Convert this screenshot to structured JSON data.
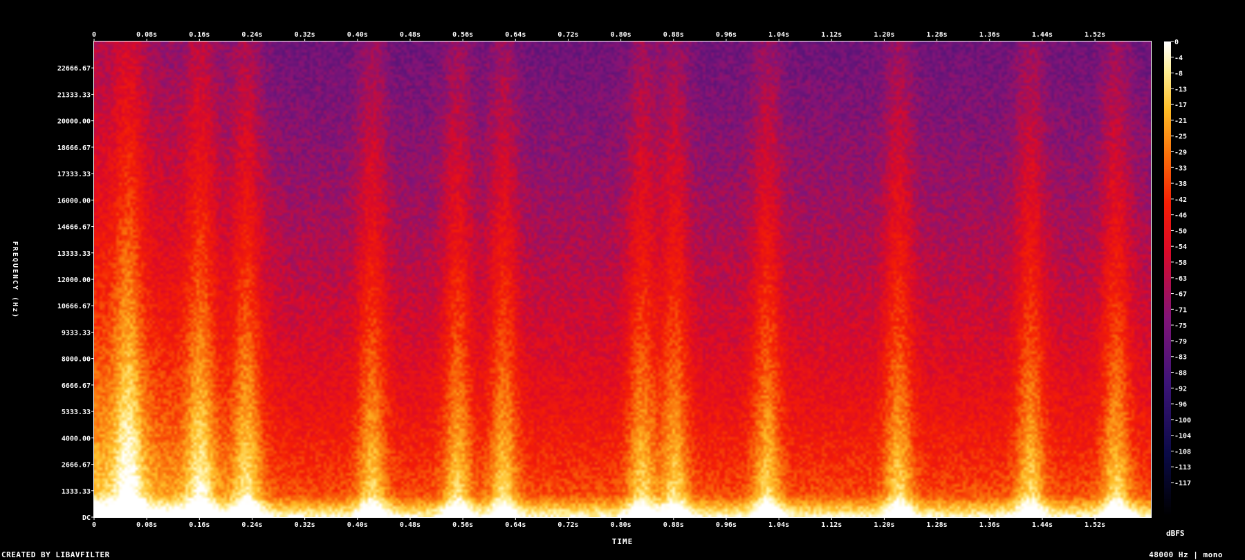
{
  "chart_data": {
    "type": "heatmap",
    "title": "",
    "xlabel": "TIME",
    "ylabel": "FREQUENCY (Hz)",
    "x_ticks": [
      "0",
      "0.08s",
      "0.16s",
      "0.24s",
      "0.32s",
      "0.40s",
      "0.48s",
      "0.56s",
      "0.64s",
      "0.72s",
      "0.80s",
      "0.88s",
      "0.96s",
      "1.04s",
      "1.12s",
      "1.20s",
      "1.28s",
      "1.36s",
      "1.44s",
      "1.52s"
    ],
    "x_tick_values": [
      0,
      0.08,
      0.16,
      0.24,
      0.32,
      0.4,
      0.48,
      0.56,
      0.64,
      0.72,
      0.8,
      0.88,
      0.96,
      1.04,
      1.12,
      1.2,
      1.28,
      1.36,
      1.44,
      1.52
    ],
    "xlim": [
      0,
      1.605
    ],
    "y_ticks": [
      "DC",
      "1333.33",
      "2666.67",
      "4000.00",
      "5333.33",
      "6666.67",
      "8000.00",
      "9333.33",
      "10666.67",
      "12000.00",
      "13333.33",
      "14666.67",
      "16000.00",
      "17333.33",
      "18666.67",
      "20000.00",
      "21333.33",
      "22666.67"
    ],
    "y_tick_values": [
      0,
      1333.33,
      2666.67,
      4000,
      5333.33,
      6666.67,
      8000,
      9333.33,
      10666.67,
      12000,
      13333.33,
      14666.67,
      16000,
      17333.33,
      18666.67,
      20000,
      21333.33,
      22666.67
    ],
    "ylim": [
      0,
      24000
    ],
    "colorbar": {
      "unit": "dBFS",
      "ticks": [
        "0",
        "-4",
        "-8",
        "-13",
        "-17",
        "-21",
        "-25",
        "-29",
        "-33",
        "-38",
        "-42",
        "-46",
        "-50",
        "-54",
        "-58",
        "-63",
        "-67",
        "-71",
        "-75",
        "-79",
        "-83",
        "-88",
        "-92",
        "-96",
        "-100",
        "-104",
        "-108",
        "-113",
        "-117"
      ],
      "range": [
        -120,
        0
      ]
    },
    "grid": false,
    "activity_bursts_s": [
      0.05,
      0.16,
      0.23,
      0.42,
      0.55,
      0.62,
      0.83,
      0.88,
      1.02,
      1.22,
      1.42,
      1.55
    ],
    "colors": {
      "background": "#000000",
      "text": "#ffffff",
      "axis": "#ffffff"
    }
  },
  "footer": {
    "credit": "CREATED BY LIBAVFILTER",
    "info": "48000 Hz | mono"
  }
}
